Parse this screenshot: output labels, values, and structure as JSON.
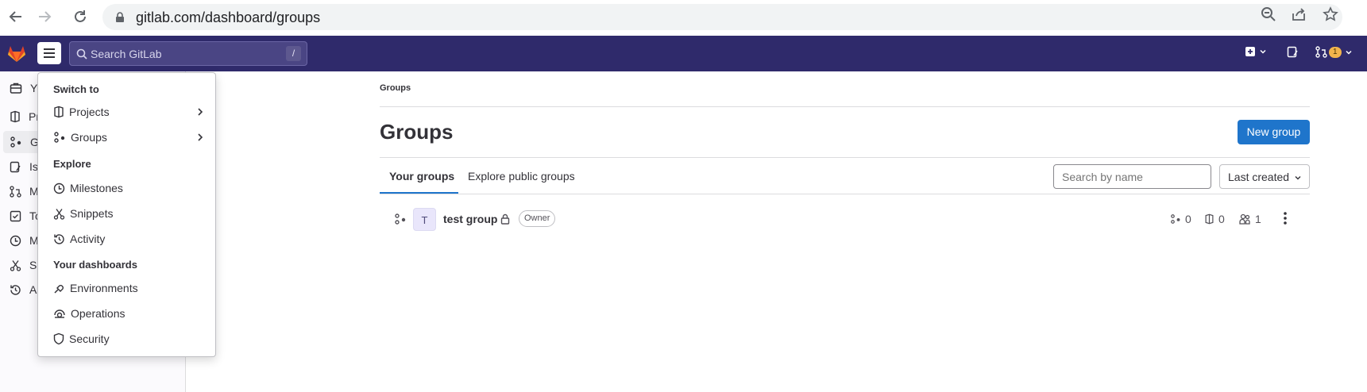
{
  "browser": {
    "url": "gitlab.com/dashboard/groups"
  },
  "topbar": {
    "search_placeholder": "Search GitLab",
    "search_shortcut": "/",
    "mr_count": "1"
  },
  "sidebar": {
    "items": [
      {
        "label": "Y",
        "icon": "work-icon"
      },
      {
        "label": "Pr",
        "icon": "project-icon"
      },
      {
        "label": "Gr",
        "icon": "group-icon"
      },
      {
        "label": "Is",
        "icon": "issues-icon"
      },
      {
        "label": "M",
        "icon": "merge-request-icon"
      },
      {
        "label": "To",
        "icon": "todo-icon"
      },
      {
        "label": "M",
        "icon": "milestone-icon"
      },
      {
        "label": "Sn",
        "icon": "snippet-icon"
      },
      {
        "label": "Ac",
        "icon": "history-icon"
      }
    ]
  },
  "dropdown": {
    "switch_heading": "Switch to",
    "switch_items": [
      {
        "label": "Projects",
        "icon": "project-icon"
      },
      {
        "label": "Groups",
        "icon": "group-icon"
      }
    ],
    "explore_heading": "Explore",
    "explore_items": [
      {
        "label": "Milestones",
        "icon": "milestone-icon"
      },
      {
        "label": "Snippets",
        "icon": "snippet-icon"
      },
      {
        "label": "Activity",
        "icon": "history-icon"
      }
    ],
    "dashboards_heading": "Your dashboards",
    "dashboard_items": [
      {
        "label": "Environments",
        "icon": "environment-icon"
      },
      {
        "label": "Operations",
        "icon": "operations-icon"
      },
      {
        "label": "Security",
        "icon": "shield-icon"
      }
    ]
  },
  "main": {
    "breadcrumb": "Groups",
    "title": "Groups",
    "new_group_label": "New group",
    "tabs": [
      {
        "label": "Your groups",
        "active": true
      },
      {
        "label": "Explore public groups",
        "active": false
      }
    ],
    "search_placeholder": "Search by name",
    "sort_label": "Last created",
    "groups": [
      {
        "avatar_letter": "T",
        "name": "test group",
        "visibility": "private",
        "role": "Owner",
        "subgroups": "0",
        "projects": "0",
        "members": "1"
      }
    ]
  },
  "colors": {
    "topbar": "#2f2a6b",
    "primary_button": "#1f75cb",
    "logo": "#e24329"
  }
}
